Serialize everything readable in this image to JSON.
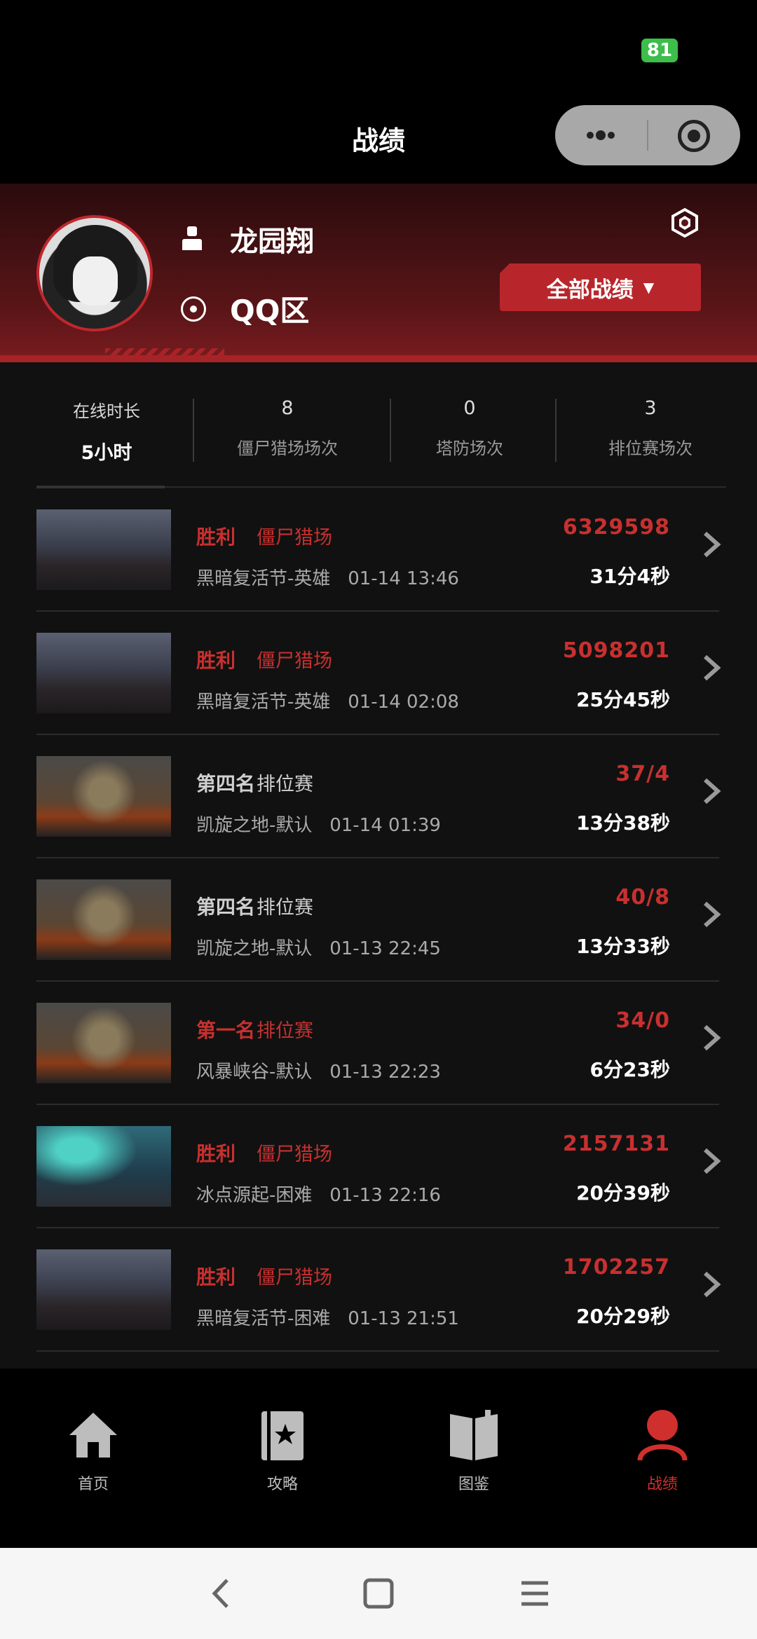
{
  "status": {
    "battery": "81"
  },
  "header": {
    "title": "战绩"
  },
  "profile": {
    "username": "龙园翔",
    "zone": "QQ区",
    "filter_label": "全部战绩",
    "filter_arrow": "▼"
  },
  "stats": [
    {
      "label": "在线时长",
      "value": "5小时"
    },
    {
      "value": "8",
      "label": "僵尸猎场场次"
    },
    {
      "value": "0",
      "label": "塔防场次"
    },
    {
      "value": "3",
      "label": "排位赛场次"
    }
  ],
  "matches": [
    {
      "result": "胜利",
      "mode": "僵尸猎场",
      "map": "黑暗复活节-英雄",
      "time": "01-14 13:46",
      "score": "6329598",
      "duration": "31分4秒",
      "highlight": true,
      "thumb": "arch"
    },
    {
      "result": "胜利",
      "mode": "僵尸猎场",
      "map": "黑暗复活节-英雄",
      "time": "01-14 02:08",
      "score": "5098201",
      "duration": "25分45秒",
      "highlight": true,
      "thumb": "arch"
    },
    {
      "result": "第四名",
      "mode": "排位赛",
      "map": "凯旋之地-默认",
      "time": "01-14 01:39",
      "score": "37/4",
      "duration": "13分38秒",
      "highlight": false,
      "thumb": "mech"
    },
    {
      "result": "第四名",
      "mode": "排位赛",
      "map": "凯旋之地-默认",
      "time": "01-13 22:45",
      "score": "40/8",
      "duration": "13分33秒",
      "highlight": false,
      "thumb": "mech"
    },
    {
      "result": "第一名",
      "mode": "排位赛",
      "map": "风暴峡谷-默认",
      "time": "01-13 22:23",
      "score": "34/0",
      "duration": "6分23秒",
      "highlight": true,
      "thumb": "mech"
    },
    {
      "result": "胜利",
      "mode": "僵尸猎场",
      "map": "冰点源起-困难",
      "time": "01-13 22:16",
      "score": "2157131",
      "duration": "20分39秒",
      "highlight": true,
      "thumb": "ice"
    },
    {
      "result": "胜利",
      "mode": "僵尸猎场",
      "map": "黑暗复活节-困难",
      "time": "01-13 21:51",
      "score": "1702257",
      "duration": "20分29秒",
      "highlight": true,
      "thumb": "arch"
    }
  ],
  "tabs": [
    {
      "label": "首页",
      "icon": "home-icon"
    },
    {
      "label": "攻略",
      "icon": "guide-book-icon"
    },
    {
      "label": "图鉴",
      "icon": "open-book-icon"
    },
    {
      "label": "战绩",
      "icon": "profile-icon",
      "active": true
    }
  ],
  "colors": {
    "accent": "#c8302f",
    "active_tab": "#d0302d",
    "inactive_tab": "#bdbdbd"
  }
}
